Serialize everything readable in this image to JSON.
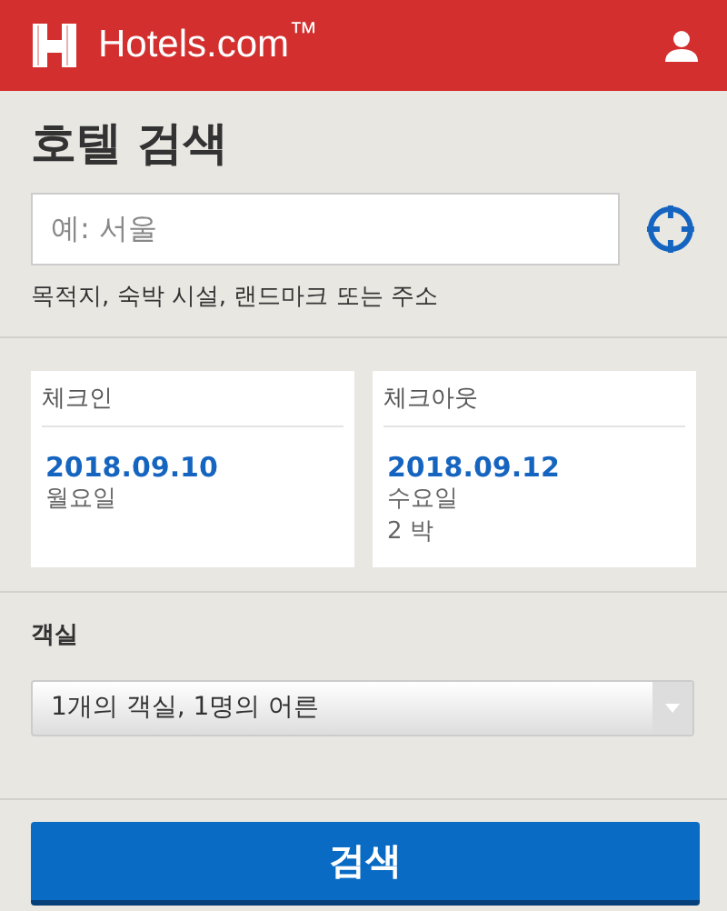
{
  "header": {
    "logo_text": "Hotels.com$^{™}$"
  },
  "search": {
    "title": "호텔 검색",
    "placeholder": "예: 서울",
    "hint": "목적지, 숙박 시설, 랜드마크 또는 주소"
  },
  "dates": [
    {
      "label": "체크인",
      "date": "2018.09.10",
      "weekday": "월요일"
    },
    {
      "label": "체크아웃",
      "date": "2018.09.12",
      "weekday": "수요일",
      "nights": "2 박"
    }
  ],
  "rooms": {
    "label": "객실",
    "value": "1개의 객실, 1명의 어른"
  },
  "submit": {
    "label": "검색"
  }
}
